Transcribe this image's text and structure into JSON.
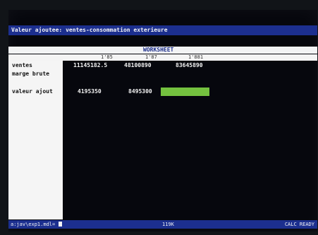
{
  "window": {
    "title": "Valeur ajoutee: ventes-consommation exterieure"
  },
  "worksheet": {
    "label": "WORKSHEET",
    "columns": [
      "1'85",
      "1'87",
      "1'881"
    ],
    "rows": [
      {
        "label": "ventes",
        "values": [
          "11145182.5",
          "48100890",
          "83645890"
        ]
      },
      {
        "label": "marge brute",
        "values": []
      },
      {
        "label": "valeur ajout",
        "values": [
          "4195350",
          "8495300",
          ""
        ]
      }
    ],
    "highlight_color": "#74c13f"
  },
  "status": {
    "file": "a:jav\\exp1.mdl=",
    "memory": "119K",
    "mode": "CALC READY"
  },
  "colors": {
    "title_bar": "#1c2f8f",
    "background": "#06070d",
    "sheet_header": "#f2f3f4",
    "highlight": "#74c13f"
  },
  "icons": {
    "cursor": "cursor-block-icon"
  }
}
